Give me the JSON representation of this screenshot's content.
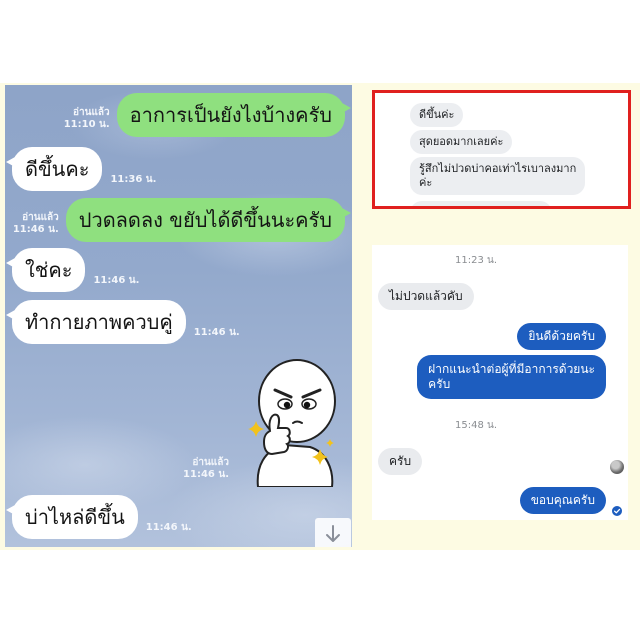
{
  "colors": {
    "page_background": "#ffffff",
    "band_background": "#fdfbe3",
    "line_chat_background": "#93a9cc",
    "line_outgoing_bubble": "#8fe07f",
    "line_incoming_bubble": "#ffffff",
    "highlight_border": "#e0201e",
    "incoming_bubble_gray": "#e9ebee",
    "outgoing_bubble_blue": "#1d5dbf"
  },
  "line_chat": {
    "messages": [
      {
        "text": "อาการเป็นยังไงบ้างครับ",
        "read_status": "อ่านแล้ว",
        "time": "11:10 น."
      },
      {
        "text": "ดีขึ้นคะ",
        "time": "11:36 น."
      },
      {
        "text": "ปวดลดลง ขยับได้ดีขึ้นนะครับ",
        "read_status": "อ่านแล้ว",
        "time": "11:46 น."
      },
      {
        "text": "ใช่คะ",
        "time": "11:46 น."
      },
      {
        "text": "ทำกายภาพควบคู่",
        "time": "11:46 น."
      },
      {
        "sticker_icon": "moon-thumbs-up-sticker",
        "read_status": "อ่านแล้ว",
        "time": "11:46 น."
      },
      {
        "text": "บ่าไหล่ดีขึ้น",
        "time": "11:46 น."
      }
    ],
    "scroll_button_icon": "arrow-down-icon"
  },
  "highlighted_chat": {
    "messages": [
      {
        "lines": [
          "ดีขึ้นค่ะ"
        ]
      },
      {
        "lines": [
          "สุดยอดมากเลยค่ะ"
        ]
      },
      {
        "lines": [
          "รู้สึกไม่ปวดบ่าคอเท่าไรเบาลงมาก",
          "ค่ะ"
        ]
      }
    ]
  },
  "messenger_chat": {
    "timestamps": [
      "11:23 น.",
      "15:48 น."
    ],
    "incoming": [
      {
        "lines": [
          "ไม่ปวดแล้วคับ"
        ]
      },
      {
        "lines": [
          "ครับ"
        ]
      }
    ],
    "outgoing": [
      {
        "lines": [
          "ยินดีด้วยครับ"
        ]
      },
      {
        "lines": [
          "ฝากแนะนำต่อผู้ที่มีอาการด้วยนะ",
          "ครับ"
        ]
      },
      {
        "lines": [
          "ขอบคุณครับ"
        ]
      }
    ],
    "avatar_icon": "contact-avatar",
    "delivered_icon": "delivered-check-icon"
  }
}
